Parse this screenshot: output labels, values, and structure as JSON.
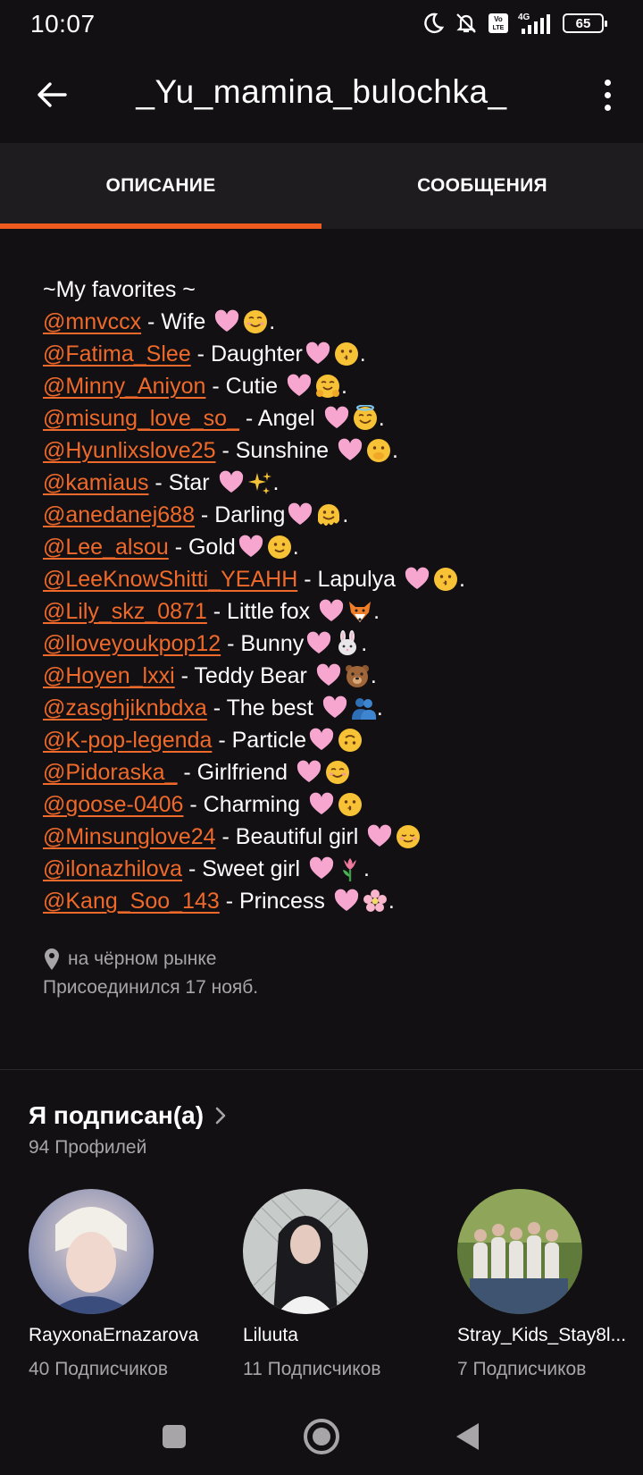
{
  "status_bar": {
    "time": "10:07",
    "battery": "65"
  },
  "app_bar": {
    "title": "_Yu_mamina_bulochka_"
  },
  "tabs": [
    {
      "label": "ОПИСАНИЕ",
      "active": true
    },
    {
      "label": "СООБЩЕНИЯ",
      "active": false
    }
  ],
  "description": {
    "heading": "~My favorites ~",
    "entries": [
      {
        "handle": "@mnvccx",
        "label": " - Wife ",
        "emojis": [
          "pink-heart",
          "smiling-face"
        ],
        "end": "."
      },
      {
        "handle": "@Fatima_Slee",
        "label": " - Daughter",
        "emojis": [
          "pink-heart",
          "kissing-face"
        ],
        "end": "."
      },
      {
        "handle": "@Minny_Aniyon",
        "label": " - Cutie ",
        "emojis": [
          "pink-heart",
          "hugging-face"
        ],
        "end": "."
      },
      {
        "handle": "@misung_love_so_",
        "label": " - Angel ",
        "emojis": [
          "pink-heart",
          "halo-face"
        ],
        "end": "."
      },
      {
        "handle": "@Hyunlixslove25",
        "label": " - Sunshine ",
        "emojis": [
          "pink-heart",
          "hand-over-mouth-face"
        ],
        "end": "."
      },
      {
        "handle": "@kamiaus",
        "label": " - Star ",
        "emojis": [
          "pink-heart",
          "sparkles"
        ],
        "end": "."
      },
      {
        "handle": "@anedanej688",
        "label": " - Darling",
        "emojis": [
          "pink-heart",
          "melting-face"
        ],
        "end": "."
      },
      {
        "handle": "@Lee_alsou",
        "label": " - Gold",
        "emojis": [
          "pink-heart",
          "slight-smile-face"
        ],
        "end": "."
      },
      {
        "handle": "@LeeKnowShitti_YEAHH",
        "label": " - Lapulya ",
        "emojis": [
          "pink-heart",
          "kissing-face"
        ],
        "end": "."
      },
      {
        "handle": "@Lily_skz_0871",
        "label": " - Little fox ",
        "emojis": [
          "pink-heart",
          "fox-face"
        ],
        "end": "."
      },
      {
        "handle": "@lloveyoukpop12",
        "label": " - Bunny",
        "emojis": [
          "pink-heart",
          "rabbit-face"
        ],
        "end": "."
      },
      {
        "handle": "@Hoyen_lxxi",
        "label": " - Teddy Bear ",
        "emojis": [
          "pink-heart",
          "bear-face"
        ],
        "end": "."
      },
      {
        "handle": "@zasghjiknbdxa",
        "label": " - The best ",
        "emojis": [
          "pink-heart",
          "people-hugging"
        ],
        "end": "."
      },
      {
        "handle": "@K-pop-legenda",
        "label": " - Particle",
        "emojis": [
          "pink-heart",
          "upside-down-face"
        ],
        "end": ""
      },
      {
        "handle": "@Pidoraska_",
        "label": " - Girlfriend ",
        "emojis": [
          "pink-heart",
          "smiling-eyes-face"
        ],
        "end": ""
      },
      {
        "handle": "@goose-0406",
        "label": " - Charming ",
        "emojis": [
          "pink-heart",
          "kissing-plain-face"
        ],
        "end": ""
      },
      {
        "handle": "@Minsunglove24",
        "label": " - Beautiful girl ",
        "emojis": [
          "pink-heart",
          "relieved-face"
        ],
        "end": ""
      },
      {
        "handle": "@ilonazhilova",
        "label": " - Sweet girl ",
        "emojis": [
          "pink-heart",
          "tulip"
        ],
        "end": "."
      },
      {
        "handle": "@Kang_Soo_143",
        "label": " - Princess ",
        "emojis": [
          "pink-heart",
          "cherry-blossom"
        ],
        "end": "."
      }
    ]
  },
  "meta": {
    "location": "на чёрном рынке",
    "joined": "Присоединился 17 нояб."
  },
  "following": {
    "title": "Я подписан(а)",
    "count": "94 Профилей",
    "profiles": [
      {
        "name": "RayxonaErnazarova",
        "subscribers": "40 Подписчиков"
      },
      {
        "name": "Liluuta",
        "subscribers": "11 Подписчиков"
      },
      {
        "name": "Stray_Kids_Stay8l...",
        "subscribers": "7 Подписчиков"
      }
    ]
  },
  "colors": {
    "accent": "#ef5a1e",
    "link": "#ef6a2a",
    "background": "#121013",
    "tab_bar": "#1e1c1f",
    "muted_text": "#a7a5a8"
  }
}
